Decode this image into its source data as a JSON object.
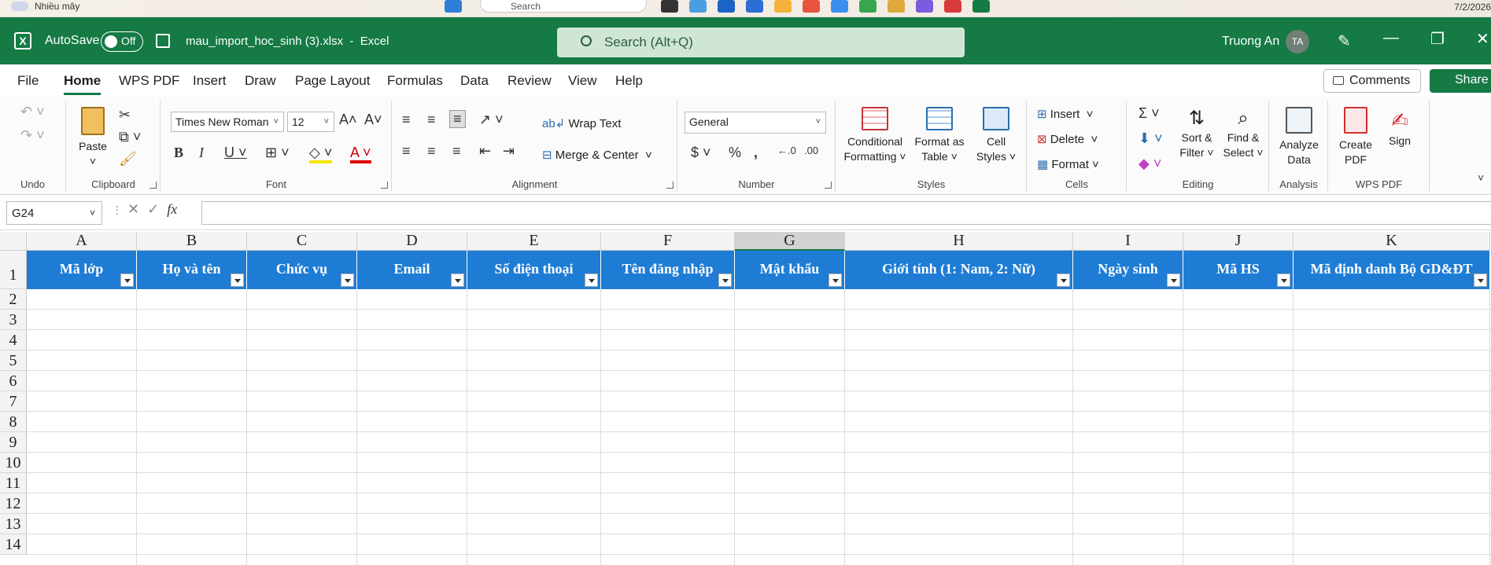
{
  "taskbar": {
    "weather": "Nhiều mây",
    "search": "Search",
    "date": "7/2/2026"
  },
  "titlebar": {
    "autosave_label": "AutoSave",
    "autosave_state": "Off",
    "filename": "mau_import_hoc_sinh (3).xlsx",
    "app": "Excel",
    "search_placeholder": "Search (Alt+Q)",
    "user_name": "Truong An",
    "user_initials": "TA"
  },
  "menu": {
    "tabs": [
      "File",
      "Home",
      "WPS PDF",
      "Insert",
      "Draw",
      "Page Layout",
      "Formulas",
      "Data",
      "Review",
      "View",
      "Help"
    ],
    "active": "Home",
    "comments": "Comments",
    "share": "Share"
  },
  "ribbon": {
    "undo_group": "Undo",
    "clipboard": {
      "label": "Clipboard",
      "paste": "Paste"
    },
    "font": {
      "label": "Font",
      "family": "Times New Roman",
      "size": "12"
    },
    "alignment": {
      "label": "Alignment",
      "wrap": "Wrap Text",
      "merge": "Merge & Center"
    },
    "number": {
      "label": "Number",
      "format": "General"
    },
    "styles": {
      "label": "Styles",
      "conditional": "Conditional",
      "conditional2": "Formatting",
      "format_as": "Format as",
      "format_as2": "Table",
      "cell": "Cell",
      "cell2": "Styles"
    },
    "cells": {
      "label": "Cells",
      "insert": "Insert",
      "delete": "Delete",
      "format": "Format"
    },
    "editing": {
      "label": "Editing",
      "sort": "Sort &",
      "sort2": "Filter",
      "find": "Find &",
      "find2": "Select"
    },
    "analysis": {
      "label": "Analysis",
      "analyze": "Analyze",
      "analyze2": "Data"
    },
    "wps": {
      "label": "WPS PDF",
      "create": "Create",
      "create2": "PDF",
      "sign": "Sign"
    }
  },
  "formula_bar": {
    "name_box": "G24",
    "fx": "fx",
    "value": ""
  },
  "sheet": {
    "columns": [
      "A",
      "B",
      "C",
      "D",
      "E",
      "F",
      "G",
      "H",
      "I",
      "J",
      "K"
    ],
    "selected_column": "G",
    "headers": [
      "Mã lớp",
      "Họ và tên",
      "Chức vụ",
      "Email",
      "Số điện thoại",
      "Tên đăng nhập",
      "Mật khẩu",
      "Giới tính (1: Nam, 2: Nữ)",
      "Ngày sinh",
      "Mã HS",
      "Mã định danh Bộ GD&ĐT"
    ],
    "rows": [
      "1",
      "2",
      "3",
      "4",
      "5",
      "6",
      "7",
      "8",
      "9",
      "10",
      "11",
      "12",
      "13",
      "14"
    ],
    "header_color": "#1f7cd4",
    "accent": "#157a44"
  }
}
